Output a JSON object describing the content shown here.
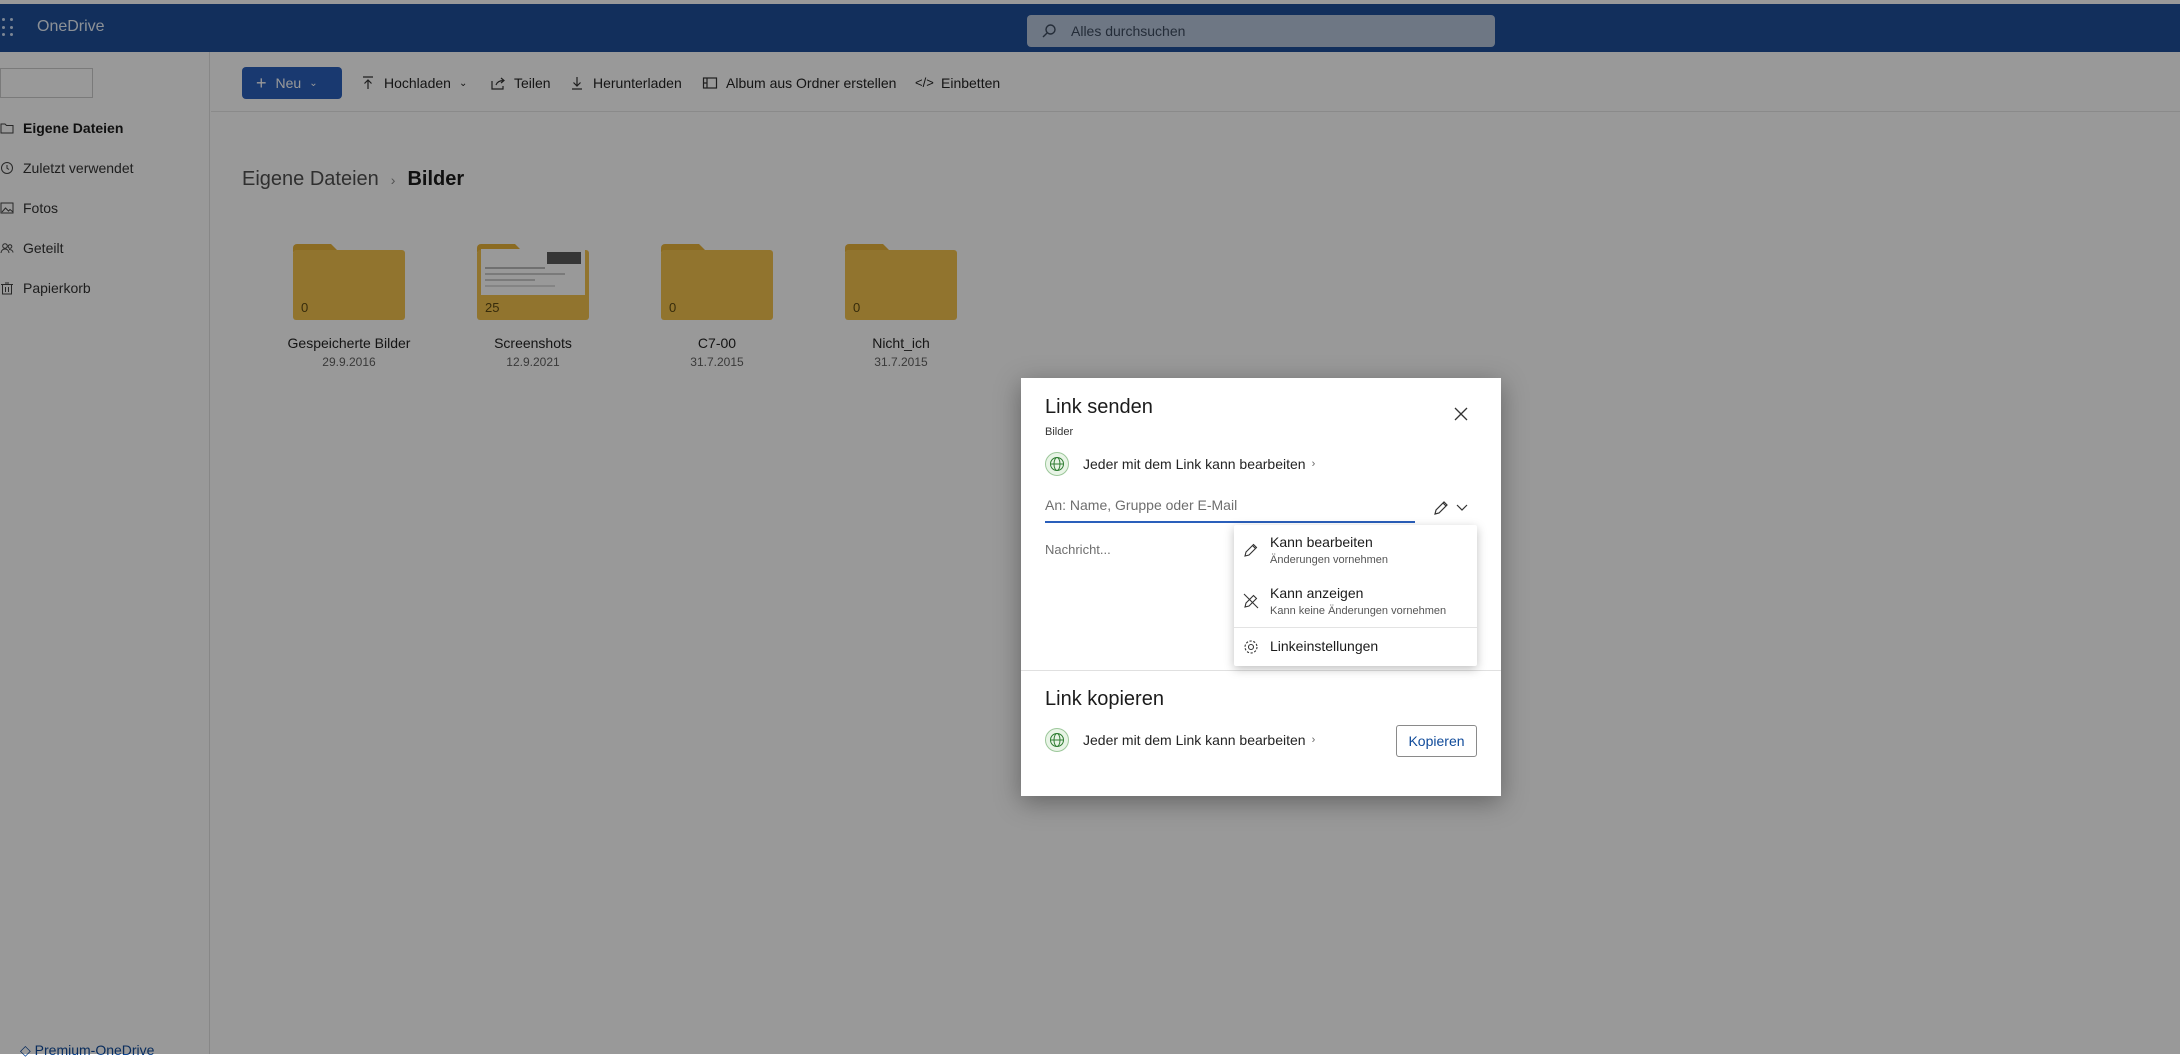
{
  "app": {
    "name": "OneDrive"
  },
  "search": {
    "placeholder": "Alles durchsuchen"
  },
  "sidebar": {
    "items": [
      {
        "label": "Eigene Dateien",
        "icon": "folder-icon"
      },
      {
        "label": "Zuletzt verwendet",
        "icon": "clock-icon"
      },
      {
        "label": "Fotos",
        "icon": "image-icon"
      },
      {
        "label": "Geteilt",
        "icon": "people-icon"
      },
      {
        "label": "Papierkorb",
        "icon": "trash-icon"
      }
    ],
    "premium_label": "Premium-OneDrive"
  },
  "toolbar": {
    "new_label": "Neu",
    "upload_label": "Hochladen",
    "share_label": "Teilen",
    "download_label": "Herunterladen",
    "album_label": "Album aus Ordner erstellen",
    "embed_label": "Einbetten"
  },
  "breadcrumb": {
    "root": "Eigene Dateien",
    "current": "Bilder"
  },
  "folders": [
    {
      "name": "Gespeicherte Bilder",
      "date": "29.9.2016",
      "count": "0"
    },
    {
      "name": "Screenshots",
      "date": "12.9.2021",
      "count": "25"
    },
    {
      "name": "C7-00",
      "date": "31.7.2015",
      "count": "0"
    },
    {
      "name": "Nicht_ich",
      "date": "31.7.2015",
      "count": "0"
    }
  ],
  "dialog": {
    "title": "Link senden",
    "subtitle": "Bilder",
    "permission": "Jeder mit dem Link kann bearbeiten",
    "to_placeholder": "An: Name, Gruppe oder E-Mail",
    "message_placeholder": "Nachricht...",
    "copy_title": "Link kopieren",
    "copy_permission": "Jeder mit dem Link kann bearbeiten",
    "copy_button": "Kopieren"
  },
  "permission_menu": {
    "edit_title": "Kann bearbeiten",
    "edit_sub": "Änderungen vornehmen",
    "view_title": "Kann anzeigen",
    "view_sub": "Kann keine Änderungen vornehmen",
    "settings_label": "Linkeinstellungen"
  },
  "colors": {
    "brand": "#1f4f99",
    "accent": "#2a5fbb",
    "folder": "#f2c14e"
  }
}
